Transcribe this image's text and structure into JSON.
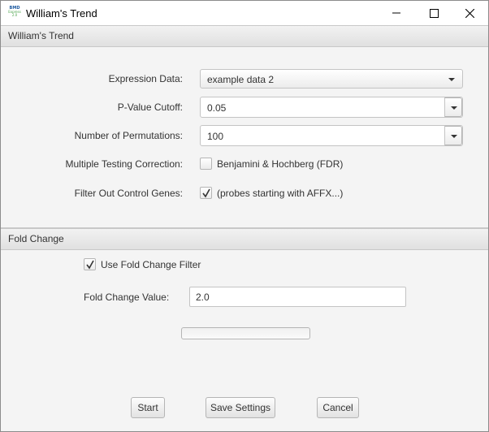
{
  "window": {
    "title": "William's Trend",
    "app_icon": "bmdexpress-icon",
    "app_icon_text_1": "BMD",
    "app_icon_text_2": "Express",
    "app_icon_text_3": "2.0"
  },
  "sections": {
    "main_title": "William's Trend",
    "fold_change_title": "Fold Change"
  },
  "form": {
    "expression_data_label": "Expression Data:",
    "expression_data_value": "example data 2",
    "pvalue_label": "P-Value Cutoff:",
    "pvalue_value": "0.05",
    "permutations_label": "Number of Permutations:",
    "permutations_value": "100",
    "mtc_label": "Multiple Testing Correction:",
    "mtc_option_label": "Benjamini & Hochberg (FDR)",
    "mtc_checked": false,
    "filter_label": "Filter Out Control Genes:",
    "filter_option_label": "(probes starting with AFFX...)",
    "filter_checked": true
  },
  "fold_change": {
    "use_filter_label": "Use Fold Change Filter",
    "use_filter_checked": true,
    "value_label": "Fold Change Value:",
    "value": "2.0",
    "progress": 0
  },
  "buttons": {
    "start": "Start",
    "save": "Save Settings",
    "cancel": "Cancel"
  }
}
